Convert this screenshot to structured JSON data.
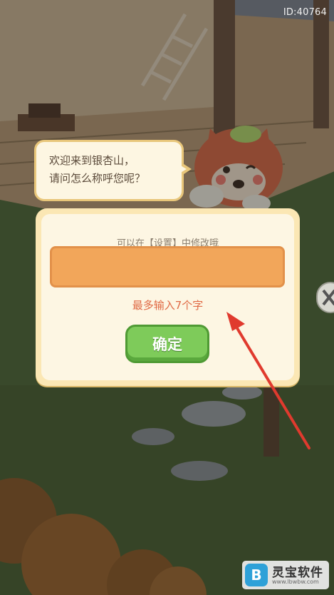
{
  "hud": {
    "player_id": "ID:40764"
  },
  "dialog": {
    "line1": "欢迎来到银杏山，",
    "line2": "请问怎么称呼您呢？"
  },
  "name_panel": {
    "hint": "可以在【设置】中修改哦",
    "input_value": "",
    "limit_hint": "最多输入7个字",
    "confirm_label": "确定"
  },
  "watermark": {
    "logo_letter": "B",
    "title": "灵宝软件",
    "url": "www.lbwbw.com"
  },
  "colors": {
    "panel_bg": "#fdf6e3",
    "input_fill": "#f2a65a",
    "limit_hint": "#e06a45",
    "confirm_green": "#7ecb5a",
    "arrow_red": "#e03a2e"
  }
}
